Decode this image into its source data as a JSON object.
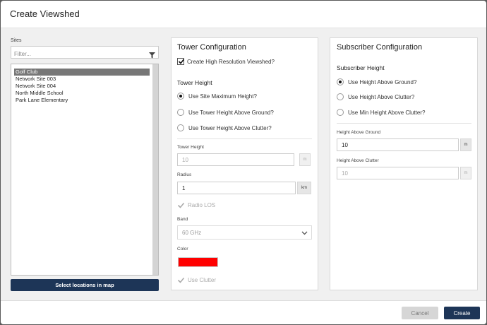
{
  "dialog": {
    "title": "Create Viewshed"
  },
  "sites": {
    "label": "Sites",
    "filter_placeholder": "Filter...",
    "items": [
      "Golf Club",
      "Network Site 003",
      "Network Site 004",
      "North Middle School",
      "Park Lane Elementary"
    ],
    "selected": "Golf Club",
    "select_button": "Select locations in map"
  },
  "tower": {
    "title": "Tower Configuration",
    "high_res_label": "Create High Resolution Viewshed?",
    "high_res_checked": true,
    "height_section": "Tower Height",
    "options": [
      "Use Site Maximum Height?",
      "Use Tower Height Above Ground?",
      "Use Tower Height Above Clutter?"
    ],
    "selected_option": "Use Site Maximum Height?",
    "height_label": "Tower Height",
    "height_value": "10",
    "height_unit": "m",
    "radius_label": "Radius",
    "radius_value": "1",
    "radius_unit": "km",
    "radio_los_label": "Radio LOS",
    "band_label": "Band",
    "band_value": "60 GHz",
    "color_label": "Color",
    "color_value": "#ff0000",
    "use_clutter_label": "Use Clutter"
  },
  "subscriber": {
    "title": "Subscriber Configuration",
    "height_section": "Subscriber Height",
    "options": [
      "Use Height Above Ground?",
      "Use Height Above Clutter?",
      "Use Min Height Above Clutter?"
    ],
    "selected_option": "Use Height Above Ground?",
    "hag_label": "Height Above Ground",
    "hag_value": "10",
    "hag_unit": "m",
    "hac_label": "Height Above Clutter",
    "hac_value": "10",
    "hac_unit": "m"
  },
  "footer": {
    "cancel_label": "Cancel",
    "create_label": "Create"
  },
  "colors": {
    "primary": "#1d3557",
    "swatch": "#ff0000"
  }
}
